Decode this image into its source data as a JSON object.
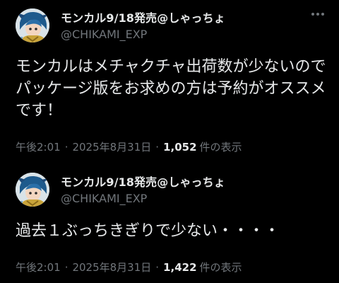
{
  "posts": [
    {
      "display_name": "モンカル9/18発売@しゃっちょ",
      "handle": "@CHIKAMI_EXP",
      "avatar_icon": "character-avatar-icon",
      "more_icon": "more-options-icon",
      "text_lines": [
        "モンカルはメチャクチャ出荷数が少ないので",
        "パッケージ版をお求めの方は予約がオススメ",
        "です！"
      ],
      "time": "午後2:01",
      "separator1": "·",
      "date": "2025年8月31日",
      "separator2": "·",
      "views_count": "1,052",
      "views_label": "件の表示"
    },
    {
      "display_name": "モンカル9/18発売@しゃっちょ",
      "handle": "@CHIKAMI_EXP",
      "avatar_icon": "character-avatar-icon",
      "text_lines": [
        "過去１ぶっちきぎりで少ない・・・・"
      ],
      "time": "午後2:01",
      "separator1": "·",
      "date": "2025年8月31日",
      "separator2": "·",
      "views_count": "1,422",
      "views_label": "件の表示"
    }
  ],
  "colors": {
    "background": "#000000",
    "primary_text": "#e7e9ea",
    "secondary_text": "#71767b"
  }
}
